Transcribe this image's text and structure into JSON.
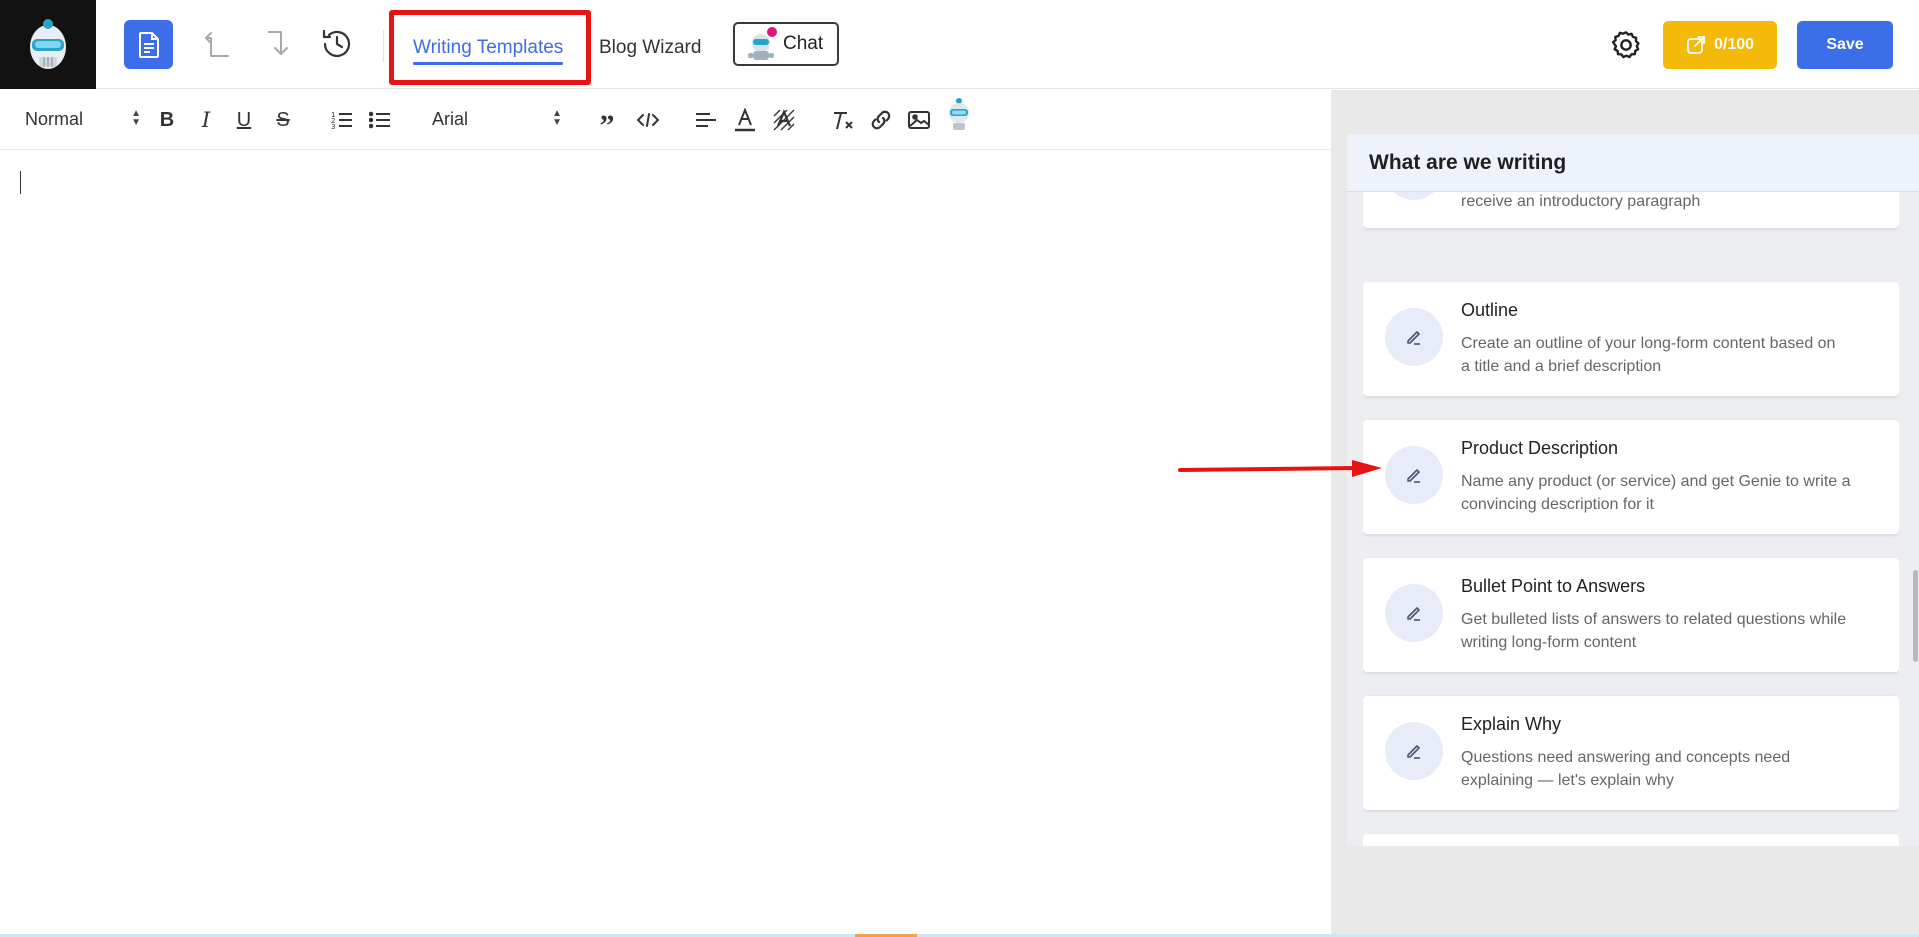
{
  "header": {
    "tabs": [
      {
        "label": "Writing Templates",
        "active": true
      },
      {
        "label": "Blog Wizard",
        "active": false
      }
    ],
    "chat_label": "Chat",
    "credits_label": "0/100",
    "save_label": "Save",
    "colors": {
      "primary": "#3b6ee8",
      "credits": "#f5b90a",
      "highlight": "#ea1313"
    }
  },
  "toolbar": {
    "block_format": "Normal",
    "font": "Arial"
  },
  "panel": {
    "title": "What are we writing",
    "partial_card_desc": "receive an introductory paragraph",
    "cards": [
      {
        "title": "Outline",
        "desc_line1": "Create an outline of your long-form content based on",
        "desc_line2": "a title and a brief description"
      },
      {
        "title": "Product Description",
        "desc_line1": "Name any product (or service) and get Genie to write a",
        "desc_line2": "convincing description for it"
      },
      {
        "title": "Bullet Point to Answers",
        "desc_line1": "Get bulleted lists of answers to related questions while",
        "desc_line2": "writing long-form content"
      },
      {
        "title": "Explain Why",
        "desc_line1": "Questions need answering and concepts need",
        "desc_line2": "explaining — let's explain why"
      }
    ]
  }
}
